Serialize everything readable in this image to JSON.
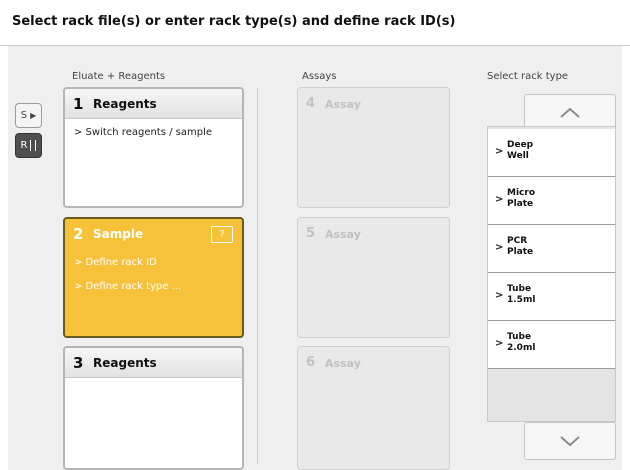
{
  "header": {
    "title": "Select rack file(s) or enter rack type(s) and define rack ID(s)"
  },
  "columns": {
    "eluate": "Eluate + Reagents",
    "assays": "Assays",
    "rack_type": "Select rack type"
  },
  "side_buttons": {
    "s_label": "S",
    "r_label": "R"
  },
  "slots": [
    {
      "num": "1",
      "name": "Reagents",
      "items": [
        "> Switch reagents / sample"
      ],
      "state": "normal"
    },
    {
      "num": "2",
      "name": "Sample",
      "items": [
        "> Define rack ID",
        "> Define rack type ..."
      ],
      "help": "?",
      "state": "selected",
      "color": "#f6c23a"
    },
    {
      "num": "3",
      "name": "Reagents",
      "items": [],
      "state": "normal"
    }
  ],
  "assays": [
    {
      "num": "4",
      "name": "Assay"
    },
    {
      "num": "5",
      "name": "Assay"
    },
    {
      "num": "6",
      "name": "Assay"
    }
  ],
  "rack_types": [
    {
      "line1": "Deep",
      "line2": "Well"
    },
    {
      "line1": "Micro",
      "line2": "Plate"
    },
    {
      "line1": "PCR",
      "line2": "Plate"
    },
    {
      "line1": "Tube",
      "line2": "1.5ml"
    },
    {
      "line1": "Tube",
      "line2": "2.0ml"
    }
  ],
  "icons": {
    "scroll_up": "chevron-up-icon",
    "scroll_down": "chevron-down-icon",
    "item": "chevron-right-icon"
  }
}
